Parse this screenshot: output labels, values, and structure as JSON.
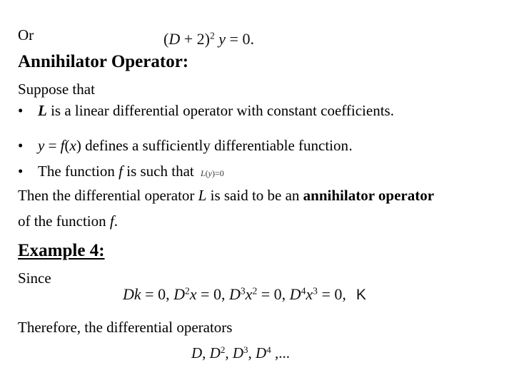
{
  "line_or": {
    "label": "Or",
    "equation": {
      "open": "(",
      "var": "D",
      "plus": " + 2",
      "close": ")",
      "exp": "2",
      "y": " y",
      "rest": " = 0."
    }
  },
  "heading_annihilator": "Annihilator Operator:",
  "suppose": "Suppose that",
  "bullets": [
    {
      "symbol": "•",
      "italic_lead": "L",
      "text": " is a linear differential operator with constant coefficients."
    },
    {
      "symbol": "•",
      "italic_y": "y",
      "eq": " = ",
      "italic_f": "f",
      "paren_open": "(",
      "italic_x": "x",
      "paren_close": ")",
      "text": " defines a sufficiently differentiable function",
      "period": "."
    },
    {
      "symbol": "•",
      "text_a": "The function ",
      "italic_f": "f",
      "text_b": " is such that ",
      "eq_L": "L",
      "eq_rest_open": "(",
      "eq_y": "y",
      "eq_rest_close": ")=0"
    }
  ],
  "conclusion": {
    "part1": "Then the differential operator ",
    "italic_L": "L",
    "part2": " is said to be an ",
    "bold": "annihilator operator",
    "line2_a": "of the function ",
    "italic_f": "f",
    "line2_b": "."
  },
  "example_heading": "Example 4:",
  "since": "Since",
  "example_equation": {
    "t1_D": "D",
    "t1_k": "k",
    "t1_eq": " = 0, ",
    "t2_D": "D",
    "t2_exp": "2",
    "t2_x": "x",
    "t2_eq": " = 0, ",
    "t3_D": "D",
    "t3_exp": "3",
    "t3_x": "x",
    "t3_xexp": "2",
    "t3_eq": " = 0, ",
    "t4_D": "D",
    "t4_exp": "4",
    "t4_x": "x",
    "t4_xexp": "3",
    "t4_eq": " = 0,",
    "ellipsis_glyph": "K"
  },
  "therefore": "Therefore, the differential operators",
  "operators_list": {
    "d1": "D",
    "sep": ", ",
    "d2": "D",
    "e2": "2",
    "d3": "D",
    "e3": "3",
    "d4": "D",
    "e4": "4",
    "tail": " ,..."
  }
}
